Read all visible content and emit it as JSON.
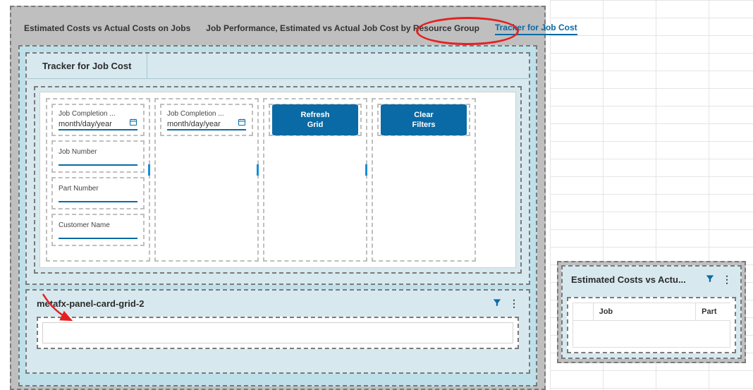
{
  "tabs": {
    "t1": "Estimated Costs vs Actual Costs on Jobs",
    "t2": "Job Performance, Estimated vs Actual Job Cost by Resource Group",
    "t3": "Tracker for Job Cost"
  },
  "card": {
    "title": "Tracker for Job Cost"
  },
  "fields": {
    "comp1_label": "Job Completion ...",
    "comp1_value": "month/day/year",
    "comp2_label": "Job Completion ...",
    "comp2_value": "month/day/year",
    "jobnum_label": "Job Number",
    "partnum_label": "Part Number",
    "custname_label": "Customer Name"
  },
  "buttons": {
    "refresh_l1": "Refresh",
    "refresh_l2": "Grid",
    "clear_l1": "Clear",
    "clear_l2": "Filters"
  },
  "grid_panel": {
    "title": "metafx-panel-card-grid-2"
  },
  "side": {
    "title": "Estimated Costs vs Actu...",
    "col_job": "Job",
    "col_part": "Part"
  }
}
